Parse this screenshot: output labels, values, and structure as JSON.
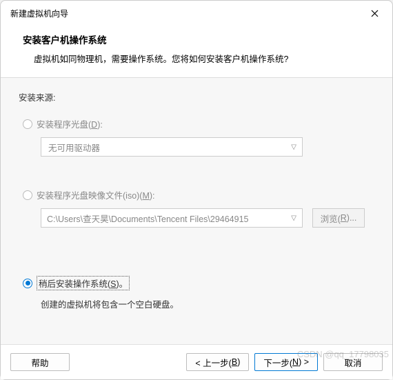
{
  "title": "新建虚拟机向导",
  "header": {
    "heading": "安装客户机操作系统",
    "subtext": "虚拟机如同物理机，需要操作系统。您将如何安装客户机操作系统?"
  },
  "section_label": "安装来源:",
  "option_disc": {
    "label_pre": "安装程序光盘(",
    "label_key": "D",
    "label_post": "):",
    "dropdown_value": "无可用驱动器"
  },
  "option_iso": {
    "label_pre": "安装程序光盘映像文件(iso)(",
    "label_key": "M",
    "label_post": "):",
    "path_value": "C:\\Users\\查天昊\\Documents\\Tencent Files\\29464915",
    "browse_pre": "浏览(",
    "browse_key": "R",
    "browse_post": ")..."
  },
  "option_later": {
    "label_pre": "稍后安装操作系统(",
    "label_key": "S",
    "label_post": ")。",
    "desc": "创建的虚拟机将包含一个空白硬盘。"
  },
  "footer": {
    "help": "帮助",
    "back_pre": "< 上一步(",
    "back_key": "B",
    "back_post": ")",
    "next_pre": "下一步(",
    "next_key": "N",
    "next_post": ") >",
    "cancel": "取消"
  },
  "watermark": "CSDN @qq_17798035"
}
